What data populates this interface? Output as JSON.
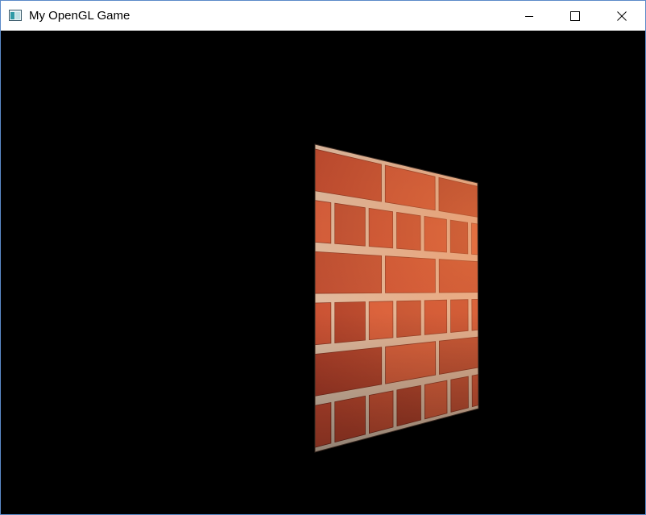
{
  "window": {
    "title": "My OpenGL Game",
    "controls": {
      "minimize": "minimize-icon",
      "maximize": "maximize-icon",
      "close": "close-icon"
    }
  },
  "scene": {
    "clear_color": "#000000",
    "object": "textured-quad",
    "texture": "red-brick-wall",
    "colors": {
      "brick": "#b8432c",
      "brick_light": "#e2684a",
      "mortar": "#dcc3ad"
    }
  }
}
